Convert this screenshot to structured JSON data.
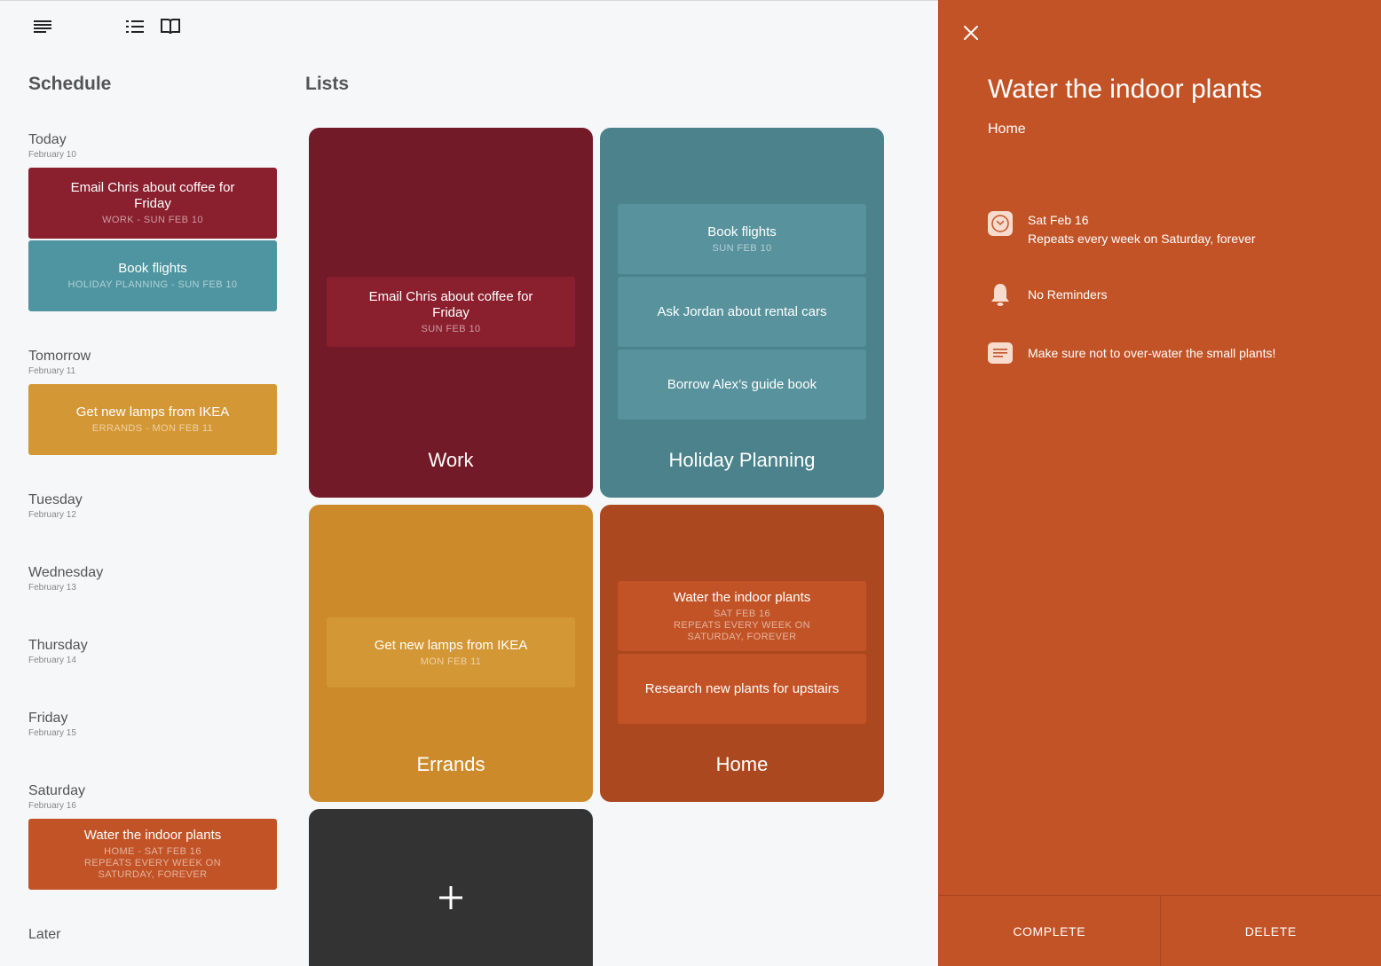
{
  "toolbar": {
    "menu_icon": "menu-icon",
    "list_view_icon": "list-icon",
    "book_view_icon": "book-icon"
  },
  "schedule": {
    "title": "Schedule",
    "days": [
      {
        "name": "Today",
        "date": "February 10"
      },
      {
        "name": "Tomorrow",
        "date": "February 11"
      },
      {
        "name": "Tuesday",
        "date": "February 12"
      },
      {
        "name": "Wednesday",
        "date": "February 13"
      },
      {
        "name": "Thursday",
        "date": "February 14"
      },
      {
        "name": "Friday",
        "date": "February 15"
      },
      {
        "name": "Saturday",
        "date": "February 16"
      },
      {
        "name": "Later",
        "date": ""
      }
    ],
    "items": [
      {
        "title": "Email Chris about coffee for Friday",
        "sub": "WORK - SUN FEB 10",
        "color": "#8a1f2e"
      },
      {
        "title": "Book flights",
        "sub": "HOLIDAY PLANNING - SUN FEB 10",
        "color": "#4f95a1"
      },
      {
        "title": "Get new lamps from IKEA",
        "sub": "ERRANDS - MON FEB 11",
        "color": "#d49735"
      },
      {
        "title": "Water the indoor plants",
        "sub": "HOME - SAT FEB 16",
        "sub2": "REPEATS EVERY WEEK ON SATURDAY, FOREVER",
        "color": "#c25326"
      }
    ]
  },
  "lists": {
    "title": "Lists",
    "cards": [
      {
        "name": "Work",
        "color": "#721a28",
        "item_color": "#8a1f2e",
        "items": [
          {
            "title": "Email Chris about coffee for Friday",
            "sub": "SUN FEB 10"
          }
        ]
      },
      {
        "name": "Holiday Planning",
        "color": "#4b828b",
        "item_color": "#58939d",
        "items": [
          {
            "title": "Book flights",
            "sub": "SUN FEB 10"
          },
          {
            "title": "Ask Jordan about rental cars",
            "sub": ""
          },
          {
            "title": "Borrow Alex’s guide book",
            "sub": ""
          }
        ]
      },
      {
        "name": "Errands",
        "color": "#cd8a2a",
        "item_color": "#d49735",
        "items": [
          {
            "title": "Get new lamps from IKEA",
            "sub": "MON FEB 11"
          }
        ]
      },
      {
        "name": "Home",
        "color": "#ab4820",
        "item_color": "#c25326",
        "items": [
          {
            "title": "Water the indoor plants",
            "sub": "SAT FEB 16",
            "sub2": "REPEATS EVERY WEEK ON SATURDAY, FOREVER"
          },
          {
            "title": "Research new plants for upstairs",
            "sub": ""
          }
        ]
      }
    ],
    "add_icon": "plus-icon"
  },
  "detail": {
    "title": "Water the indoor plants",
    "list": "Home",
    "date": "Sat Feb 16",
    "repeat": "Repeats every week on Saturday, forever",
    "reminders": "No Reminders",
    "note": "Make sure not to over-water the small plants!",
    "complete_label": "COMPLETE",
    "delete_label": "DELETE",
    "bg_color": "#c25326"
  }
}
